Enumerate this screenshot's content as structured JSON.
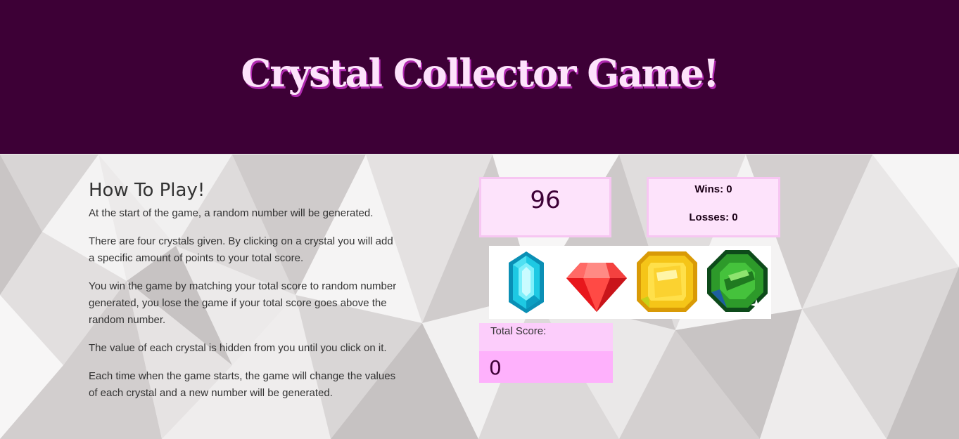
{
  "header": {
    "title": "Crystal Collector Game!"
  },
  "instructions": {
    "heading": "How To Play!",
    "paragraphs": [
      "At the start of the game, a random number will be generated.",
      "There are four crystals given. By clicking on a crystal you will add a specific amount of points to your total score.",
      "You win the game by matching your total score to random number generated, you lose the game if your total score goes above the random number.",
      "The value of each crystal is hidden from you until you click on it.",
      "Each time when the game starts, the game will change the values of each crystal and a new number will be generated."
    ]
  },
  "game": {
    "target_number": "96",
    "wins_text": "Wins: 0",
    "losses_text": "Losses: 0",
    "total_score_label": "Total Score:",
    "total_score": "0"
  },
  "crystals": [
    {
      "icon": "blue-crystal-icon",
      "color": "#1ec9e3"
    },
    {
      "icon": "red-crystal-icon",
      "color": "#e8171c"
    },
    {
      "icon": "yellow-crystal-icon",
      "color": "#f5c518"
    },
    {
      "icon": "green-crystal-icon",
      "color": "#2d9a2a"
    }
  ],
  "colors": {
    "header_bg": "#3d0036",
    "title_text": "#fde3fb",
    "panel_bg": "#fde3fb",
    "panel_border": "#f7c6f2",
    "score_label_bg": "#fccdfb",
    "score_value_bg": "#feb1fc"
  }
}
